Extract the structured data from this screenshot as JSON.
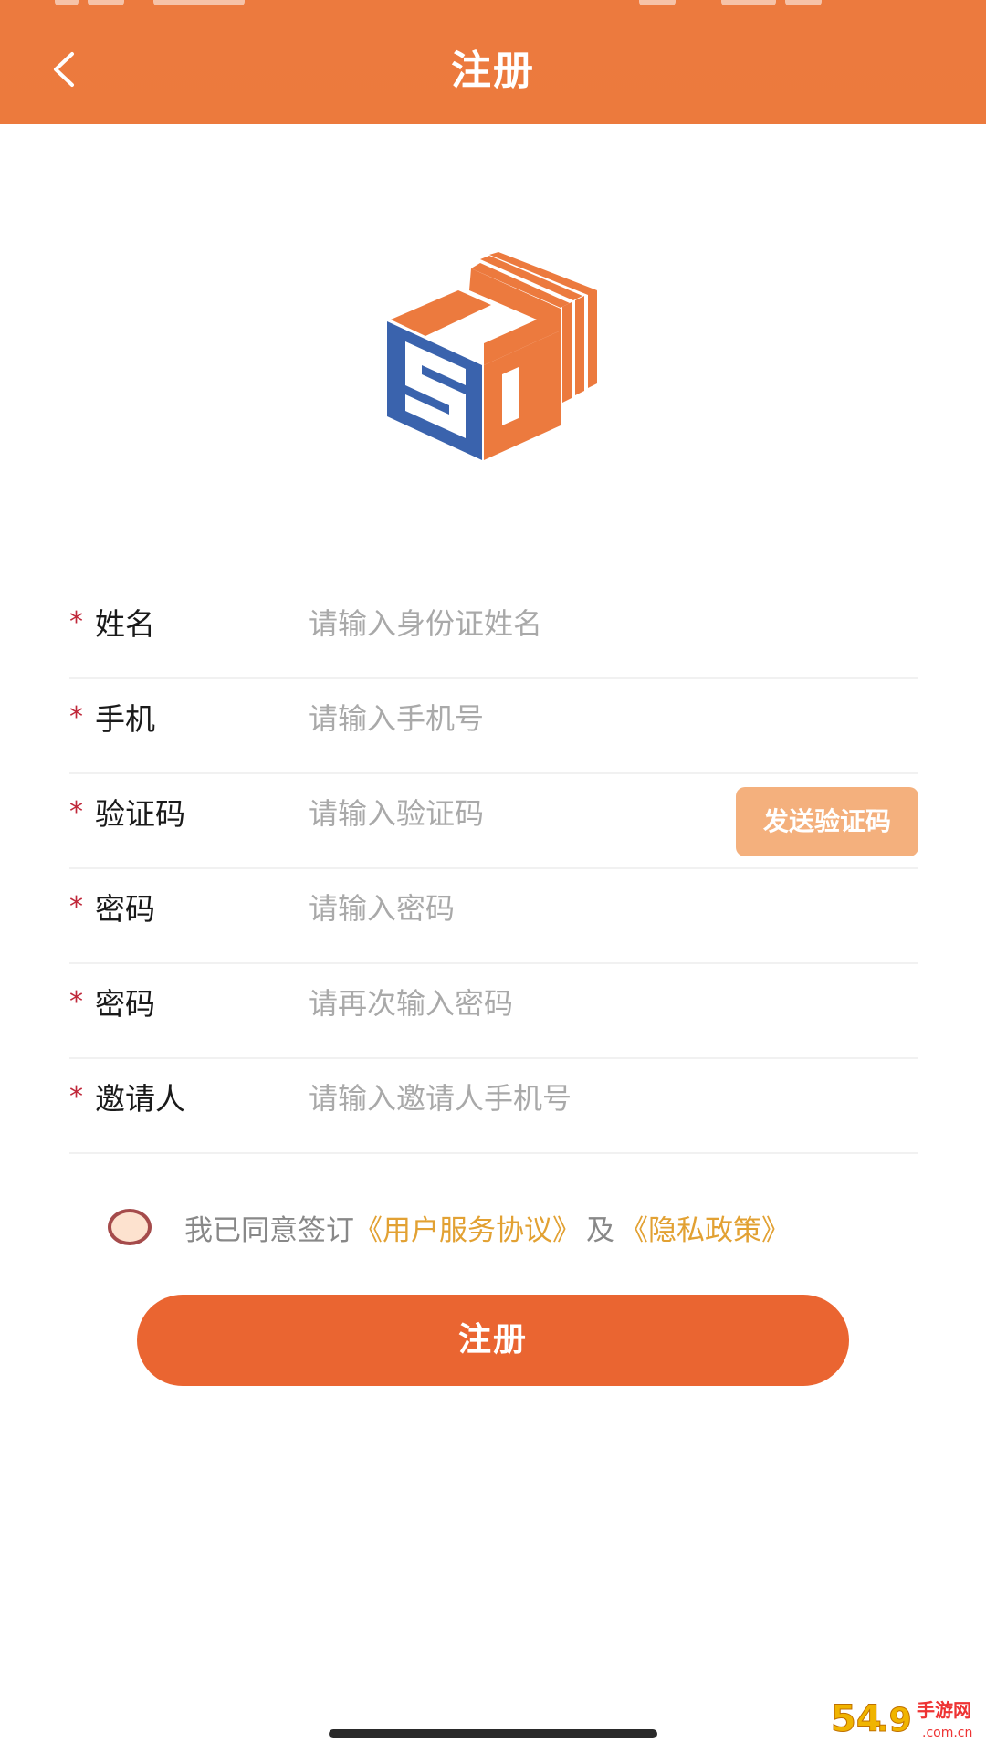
{
  "header": {
    "title": "注册"
  },
  "form": {
    "fields": [
      {
        "required_mark": "*",
        "label": "姓名",
        "placeholder": "请输入身份证姓名"
      },
      {
        "required_mark": "*",
        "label": "手机",
        "placeholder": "请输入手机号"
      },
      {
        "required_mark": "*",
        "label": "验证码",
        "placeholder": "请输入验证码"
      },
      {
        "required_mark": "*",
        "label": "密码",
        "placeholder": "请输入密码"
      },
      {
        "required_mark": "*",
        "label": "密码",
        "placeholder": "请再次输入密码"
      },
      {
        "required_mark": "*",
        "label": "邀请人",
        "placeholder": "请输入邀请人手机号"
      }
    ],
    "send_code_label": "发送验证码"
  },
  "agreement": {
    "prefix": "我已同意签订",
    "user_agreement": "《用户服务协议》",
    "connector": "及",
    "privacy_policy": "《隐私政策》"
  },
  "submit": {
    "label": "注册"
  },
  "watermark": {
    "text": "54.9手游网 .com.cn"
  },
  "colors": {
    "brand_orange": "#ec7a3e",
    "submit_orange": "#ea6531",
    "send_code_bg": "#f4b07d",
    "link_gold": "#e2a133",
    "required_red": "#c0283a",
    "logo_blue": "#3a63ad"
  }
}
